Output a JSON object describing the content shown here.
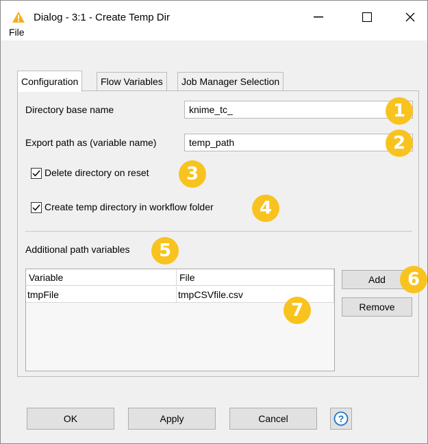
{
  "window": {
    "title": "Dialog - 3:1 - Create Temp Dir",
    "minimize_glyph": "—",
    "maximize_glyph": "☐",
    "close_glyph": "✕",
    "icon": "warning-triangle-icon"
  },
  "menubar": {
    "file": "File"
  },
  "tabs": [
    {
      "label": "Configuration",
      "active": true
    },
    {
      "label": "Flow Variables",
      "active": false
    },
    {
      "label": "Job Manager Selection",
      "active": false
    }
  ],
  "config": {
    "dir_base_name_label": "Directory base name",
    "dir_base_name_value": "knime_tc_",
    "export_path_label": "Export path as (variable name)",
    "export_path_value": "temp_path",
    "delete_on_reset_label": "Delete directory on reset",
    "delete_on_reset_checked": true,
    "create_in_workflow_label": "Create temp directory in workflow folder",
    "create_in_workflow_checked": true,
    "additional_label": "Additional path variables"
  },
  "table": {
    "headers": [
      "Variable",
      "File"
    ],
    "rows": [
      [
        "tmpFile",
        "tmpCSVfile.csv"
      ]
    ]
  },
  "side_buttons": {
    "add": "Add",
    "remove": "Remove"
  },
  "footer": {
    "ok": "OK",
    "apply": "Apply",
    "cancel": "Cancel",
    "help": "?"
  },
  "badges": [
    "1",
    "2",
    "3",
    "4",
    "5",
    "6",
    "7"
  ],
  "colors": {
    "badge": "#f8c31f",
    "help": "#1a73c9",
    "warning": "#f3b01c"
  }
}
